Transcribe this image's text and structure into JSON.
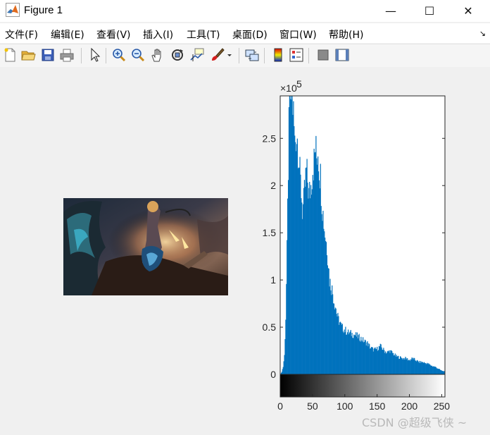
{
  "window": {
    "title": "Figure 1",
    "minimize_glyph": "—",
    "maximize_glyph": "☐",
    "close_glyph": "✕"
  },
  "menu": {
    "items": [
      "文件(F)",
      "编辑(E)",
      "查看(V)",
      "插入(I)",
      "工具(T)",
      "桌面(D)",
      "窗口(W)",
      "帮助(H)"
    ],
    "dock_arrow": "↘"
  },
  "toolbar": {
    "icons": [
      "new-figure-icon",
      "open-file-icon",
      "save-icon",
      "print-icon",
      "edit-plot-arrow-icon",
      "zoom-in-icon",
      "zoom-out-icon",
      "pan-hand-icon",
      "rotate-3d-icon",
      "data-cursor-icon",
      "brush-icon",
      "brush-dropdown-icon",
      "link-plot-icon",
      "colorbar-icon",
      "legend-icon",
      "hide-plot-tools-icon",
      "show-plot-tools-icon"
    ]
  },
  "image_panel": {
    "content": "fantasy-artwork-thumbnail"
  },
  "chart_data": {
    "type": "bar",
    "title": "",
    "xlabel": "",
    "ylabel": "",
    "exponent_label_prefix": "×10",
    "exponent_label_power": "5",
    "xlim": [
      0,
      255
    ],
    "ylim": [
      0,
      2.95
    ],
    "x_ticks": [
      0,
      50,
      100,
      150,
      200,
      250
    ],
    "x_tick_labels": [
      "0",
      "50",
      "100",
      "150",
      "200",
      "250"
    ],
    "y_ticks": [
      0,
      0.5,
      1,
      1.5,
      2,
      2.5
    ],
    "y_tick_labels": [
      "0",
      "0.5",
      "1",
      "1.5",
      "2",
      "2.5"
    ],
    "bar_color": "#0072bd",
    "colorbar": "grayscale 0-255",
    "profile_points": [
      [
        0,
        0.0
      ],
      [
        2,
        0.03
      ],
      [
        4,
        0.08
      ],
      [
        6,
        0.2
      ],
      [
        8,
        0.6
      ],
      [
        10,
        1.3
      ],
      [
        12,
        2.2
      ],
      [
        14,
        2.95
      ],
      [
        16,
        2.95
      ],
      [
        18,
        2.95
      ],
      [
        20,
        2.75
      ],
      [
        22,
        2.45
      ],
      [
        24,
        2.55
      ],
      [
        26,
        2.5
      ],
      [
        28,
        2.35
      ],
      [
        30,
        2.1
      ],
      [
        32,
        1.95
      ],
      [
        34,
        1.75
      ],
      [
        36,
        1.8
      ],
      [
        38,
        2.0
      ],
      [
        40,
        2.15
      ],
      [
        42,
        2.05
      ],
      [
        44,
        1.9
      ],
      [
        46,
        1.95
      ],
      [
        48,
        2.05
      ],
      [
        50,
        2.2
      ],
      [
        52,
        2.25
      ],
      [
        54,
        2.4
      ],
      [
        56,
        2.3
      ],
      [
        58,
        2.4
      ],
      [
        60,
        2.2
      ],
      [
        62,
        2.1
      ],
      [
        64,
        1.85
      ],
      [
        66,
        1.7
      ],
      [
        68,
        1.55
      ],
      [
        70,
        1.45
      ],
      [
        72,
        1.35
      ],
      [
        74,
        1.2
      ],
      [
        76,
        1.0
      ],
      [
        78,
        0.95
      ],
      [
        80,
        0.9
      ],
      [
        82,
        0.82
      ],
      [
        84,
        0.75
      ],
      [
        86,
        0.7
      ],
      [
        88,
        0.62
      ],
      [
        90,
        0.58
      ],
      [
        95,
        0.5
      ],
      [
        100,
        0.47
      ],
      [
        105,
        0.44
      ],
      [
        110,
        0.43
      ],
      [
        115,
        0.42
      ],
      [
        120,
        0.4
      ],
      [
        125,
        0.38
      ],
      [
        130,
        0.35
      ],
      [
        135,
        0.33
      ],
      [
        140,
        0.28
      ],
      [
        145,
        0.26
      ],
      [
        150,
        0.27
      ],
      [
        155,
        0.3
      ],
      [
        160,
        0.26
      ],
      [
        165,
        0.23
      ],
      [
        170,
        0.25
      ],
      [
        175,
        0.22
      ],
      [
        180,
        0.19
      ],
      [
        185,
        0.18
      ],
      [
        190,
        0.17
      ],
      [
        195,
        0.17
      ],
      [
        200,
        0.15
      ],
      [
        205,
        0.17
      ],
      [
        210,
        0.15
      ],
      [
        215,
        0.13
      ],
      [
        220,
        0.13
      ],
      [
        225,
        0.12
      ],
      [
        230,
        0.11
      ],
      [
        235,
        0.09
      ],
      [
        240,
        0.08
      ],
      [
        245,
        0.06
      ],
      [
        250,
        0.04
      ],
      [
        255,
        0.03
      ]
    ]
  },
  "watermark": {
    "text": "CSDN @超级飞侠 ~"
  }
}
